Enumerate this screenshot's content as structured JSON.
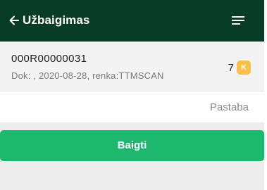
{
  "header": {
    "title": "Užbaigimas",
    "back_icon": "arrow-left-icon",
    "menu_icon": "menu-icon"
  },
  "document": {
    "number": "000R00000031",
    "meta": "Dok: , 2020-08-28, renka:TTMSCAN",
    "count": "7",
    "badge": "K"
  },
  "note": {
    "placeholder": "Pastaba",
    "value": ""
  },
  "actions": {
    "finish_label": "Baigti"
  },
  "colors": {
    "header_bg": "#083c26",
    "accent_green": "#1db86e",
    "badge_yellow": "#fbbf46"
  }
}
